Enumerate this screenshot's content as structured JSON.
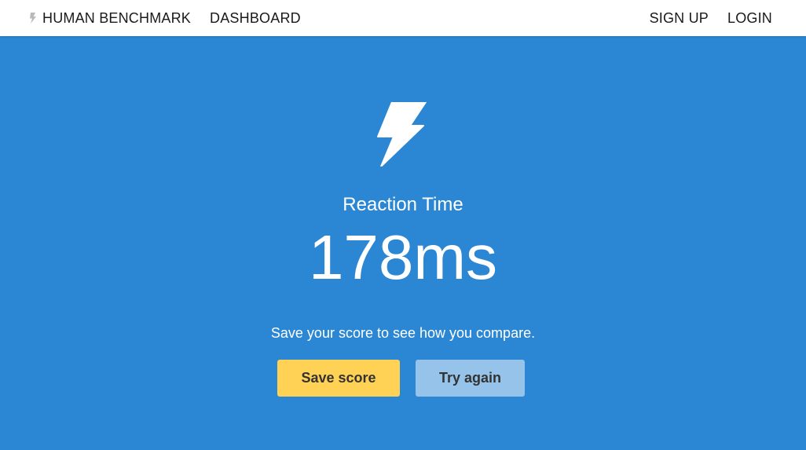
{
  "nav": {
    "brand_label": "HUMAN BENCHMARK",
    "brand_icon": "lightning-bolt-icon",
    "dashboard_label": "DASHBOARD",
    "signup_label": "SIGN UP",
    "login_label": "LOGIN"
  },
  "hero": {
    "icon": "lightning-bolt-icon",
    "title": "Reaction Time",
    "score": "178ms",
    "subtitle": "Save your score to see how you compare.",
    "save_label": "Save score",
    "retry_label": "Try again"
  },
  "colors": {
    "hero_background": "#2b87d3",
    "save_button": "#ffd154",
    "retry_button": "#95c3e9",
    "nav_background": "#ffffff"
  }
}
